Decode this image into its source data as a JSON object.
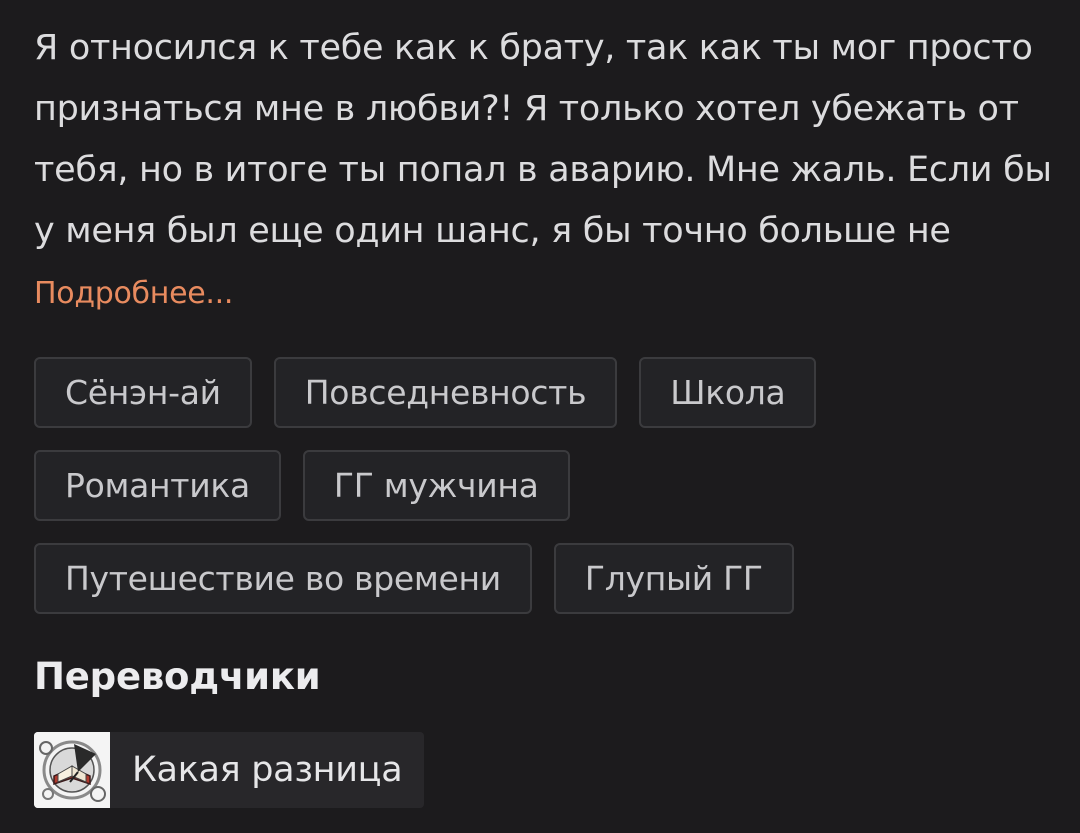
{
  "description": {
    "text": "Я относился к тебе как к брату, так как ты мог просто признаться мне в любви?! Я только хотел убежать от тебя, но в итоге ты попал в аварию. Мне жаль. Если бы у меня был еще один шанс, я бы точно больше не",
    "more_label": "Подробнее..."
  },
  "tags": [
    "Сёнэн-ай",
    "Повседневность",
    "Школа",
    "Романтика",
    "ГГ мужчина",
    "Путешествие во времени",
    "Глупый ГГ"
  ],
  "translators_section": {
    "title": "Переводчики",
    "items": [
      {
        "name": "Какая разница",
        "avatar_icon": "book-quill-logo-icon"
      }
    ]
  },
  "colors": {
    "background": "#1c1b1d",
    "accent_link": "#e88b5f",
    "tag_border": "#3b3b3e",
    "tag_background": "#232326"
  }
}
